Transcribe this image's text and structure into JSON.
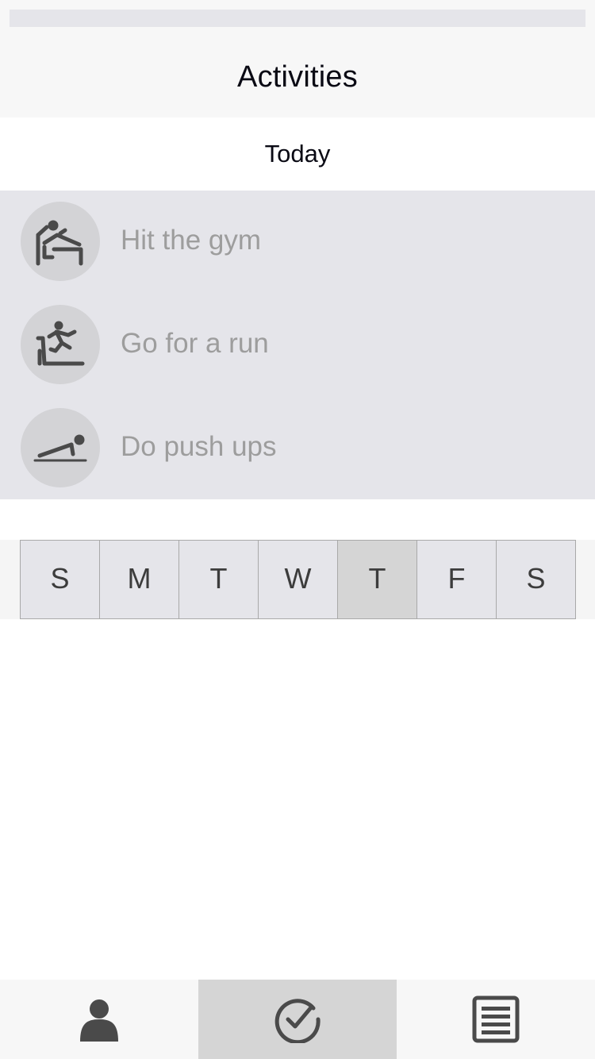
{
  "header": {
    "title": "Activities"
  },
  "section": {
    "title": "Today"
  },
  "activities": [
    {
      "label": "Hit the gym",
      "icon": "bench-press-icon"
    },
    {
      "label": "Go for a run",
      "icon": "treadmill-icon"
    },
    {
      "label": "Do push ups",
      "icon": "push-up-icon"
    }
  ],
  "week": {
    "days": [
      "S",
      "M",
      "T",
      "W",
      "T",
      "F",
      "S"
    ],
    "selected_index": 4
  },
  "tabbar": {
    "tabs": [
      {
        "icon": "profile-icon"
      },
      {
        "icon": "checkmark-circle-icon",
        "active": true
      },
      {
        "icon": "list-icon"
      }
    ]
  },
  "colors": {
    "background": "#ffffff",
    "bar": "#f7f7f7",
    "list_bg": "#e5e5ea",
    "icon_circle": "#d3d3d6",
    "selected": "#d5d5d5",
    "icon_fill": "#4a4a4a",
    "muted_text": "#9d9d9d"
  }
}
